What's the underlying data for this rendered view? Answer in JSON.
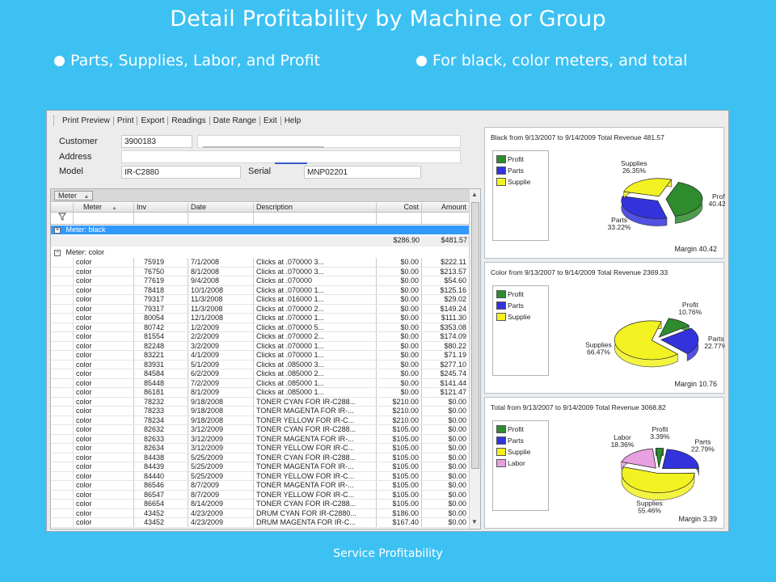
{
  "slide": {
    "title": "Detail Profitability by Machine or Group",
    "bullet_left": "Parts, Supplies, Labor, and Profit",
    "bullet_right": "For black, color meters, and total",
    "footer": "Service Profitability"
  },
  "menu": [
    "Print Preview",
    "Print",
    "Export",
    "Readings",
    "Date Range",
    "Exit",
    "Help"
  ],
  "form": {
    "customer_label": "Customer",
    "customer_value": "3900183",
    "address_label": "Address",
    "model_label": "Model",
    "model_value": "IR-C2880",
    "serial_label": "Serial",
    "serial_value": "MNP02201"
  },
  "grid": {
    "group_chip": "Meter",
    "columns": [
      "Meter",
      "Inv",
      "Date",
      "Description",
      "Cost",
      "Amount"
    ],
    "group_black_label": "Meter:  black",
    "summary_cost": "$286.90",
    "summary_amount": "$481.57",
    "group_color_label": "Meter:  color",
    "rows": [
      [
        "color",
        "75919",
        "7/1/2008",
        "Clicks at   .070000        3...",
        "$0.00",
        "$222.11"
      ],
      [
        "color",
        "76750",
        "8/1/2008",
        "Clicks at   .070000        3...",
        "$0.00",
        "$213.57"
      ],
      [
        "color",
        "77619",
        "9/4/2008",
        "Clicks at   .070000",
        "$0.00",
        "$54.60"
      ],
      [
        "color",
        "78418",
        "10/1/2008",
        "Clicks at   .070000        1...",
        "$0.00",
        "$125.16"
      ],
      [
        "color",
        "79317",
        "11/3/2008",
        "Clicks at   .016000        1...",
        "$0.00",
        "$29.02"
      ],
      [
        "color",
        "79317",
        "11/3/2008",
        "Clicks at   .070000        2...",
        "$0.00",
        "$149.24"
      ],
      [
        "color",
        "80054",
        "12/1/2008",
        "Clicks at   .070000        1...",
        "$0.00",
        "$111.30"
      ],
      [
        "color",
        "80742",
        "1/2/2009",
        "Clicks at   .070000        5...",
        "$0.00",
        "$353.08"
      ],
      [
        "color",
        "81554",
        "2/2/2009",
        "Clicks at   .070000        2...",
        "$0.00",
        "$174.09"
      ],
      [
        "color",
        "82248",
        "3/2/2009",
        "Clicks at   .070000        1...",
        "$0.00",
        "$80.22"
      ],
      [
        "color",
        "83221",
        "4/1/2009",
        "Clicks at   .070000        1...",
        "$0.00",
        "$71.19"
      ],
      [
        "color",
        "83931",
        "5/1/2009",
        "Clicks at   .085000        3...",
        "$0.00",
        "$277.10"
      ],
      [
        "color",
        "84584",
        "6/2/2009",
        "Clicks at   .085000        2...",
        "$0.00",
        "$245.74"
      ],
      [
        "color",
        "85448",
        "7/2/2009",
        "Clicks at   .085000        1...",
        "$0.00",
        "$141.44"
      ],
      [
        "color",
        "86181",
        "8/1/2009",
        "Clicks at   .085000        1...",
        "$0.00",
        "$121.47"
      ],
      [
        "color",
        "78232",
        "9/18/2008",
        "TONER CYAN FOR IR-C288...",
        "$210.00",
        "$0.00"
      ],
      [
        "color",
        "78233",
        "9/18/2008",
        "TONER MAGENTA FOR IR-...",
        "$210.00",
        "$0.00"
      ],
      [
        "color",
        "78234",
        "9/18/2008",
        "TONER YELLOW FOR IR-C...",
        "$210.00",
        "$0.00"
      ],
      [
        "color",
        "82632",
        "3/12/2009",
        "TONER CYAN FOR IR-C288...",
        "$105.00",
        "$0.00"
      ],
      [
        "color",
        "82633",
        "3/12/2009",
        "TONER MAGENTA FOR IR-...",
        "$105.00",
        "$0.00"
      ],
      [
        "color",
        "82634",
        "3/12/2009",
        "TONER YELLOW FOR IR-C...",
        "$105.00",
        "$0.00"
      ],
      [
        "color",
        "84438",
        "5/25/2009",
        "TONER CYAN FOR IR-C288...",
        "$105.00",
        "$0.00"
      ],
      [
        "color",
        "84439",
        "5/25/2009",
        "TONER MAGENTA FOR IR-...",
        "$105.00",
        "$0.00"
      ],
      [
        "color",
        "84440",
        "5/25/2009",
        "TONER YELLOW FOR IR-C...",
        "$105.00",
        "$0.00"
      ],
      [
        "color",
        "86546",
        "8/7/2009",
        "TONER MAGENTA FOR IR-...",
        "$105.00",
        "$0.00"
      ],
      [
        "color",
        "86547",
        "8/7/2009",
        "TONER YELLOW FOR IR-C...",
        "$105.00",
        "$0.00"
      ],
      [
        "color",
        "86654",
        "8/14/2009",
        "TONER CYAN FOR IR-C288...",
        "$105.00",
        "$0.00"
      ],
      [
        "color",
        "43452",
        "4/23/2009",
        "DRUM CYAN FOR IR-C2880...",
        "$186.00",
        "$0.00"
      ],
      [
        "color",
        "43452",
        "4/23/2009",
        "DRUM MAGENTA FOR IR-C...",
        "$167.40",
        "$0.00"
      ]
    ]
  },
  "colors": {
    "Profit": "#2e8b2e",
    "Parts": "#3333dd",
    "Supplies": "#f2f222",
    "Labor": "#e8a0e0"
  },
  "chart_data": [
    {
      "type": "pie",
      "title": "Black from 9/13/2007 to 9/14/2009 Total Revenue 481.57",
      "legend": [
        "Profit",
        "Parts",
        "Supplie"
      ],
      "slices": [
        {
          "name": "Profit",
          "label": "Profit",
          "value": 40.42,
          "display": "40.42%"
        },
        {
          "name": "Parts",
          "label": "Parts",
          "value": 33.22,
          "display": "33.22%"
        },
        {
          "name": "Supplies",
          "label": "Supplies",
          "value": 26.35,
          "display": "26.35%"
        }
      ],
      "margin_text": "Margin 40.42"
    },
    {
      "type": "pie",
      "title": "Color from 9/13/2007 to 9/14/2009 Total Revenue 2369.33",
      "legend": [
        "Profit",
        "Parts",
        "Supplie"
      ],
      "slices": [
        {
          "name": "Profit",
          "label": "Profit",
          "value": 10.76,
          "display": "10.76%"
        },
        {
          "name": "Parts",
          "label": "Parts",
          "value": 22.77,
          "display": "22.77%"
        },
        {
          "name": "Supplies",
          "label": "Supplies",
          "value": 66.47,
          "display": "66.47%"
        }
      ],
      "margin_text": "Margin 10.76"
    },
    {
      "type": "pie",
      "title": "Total from 9/13/2007 to 9/14/2009 Total Revenue 3068.82",
      "legend": [
        "Profit",
        "Parts",
        "Supplie",
        "Labor"
      ],
      "slices": [
        {
          "name": "Profit",
          "label": "Profit",
          "value": 3.39,
          "display": "3.39%"
        },
        {
          "name": "Parts",
          "label": "Parts",
          "value": 22.79,
          "display": "22.79%"
        },
        {
          "name": "Supplies",
          "label": "Supplies",
          "value": 55.46,
          "display": "55.46%"
        },
        {
          "name": "Labor",
          "label": "Labor",
          "value": 18.36,
          "display": "18.36%"
        }
      ],
      "margin_text": "Margin 3.39"
    }
  ]
}
